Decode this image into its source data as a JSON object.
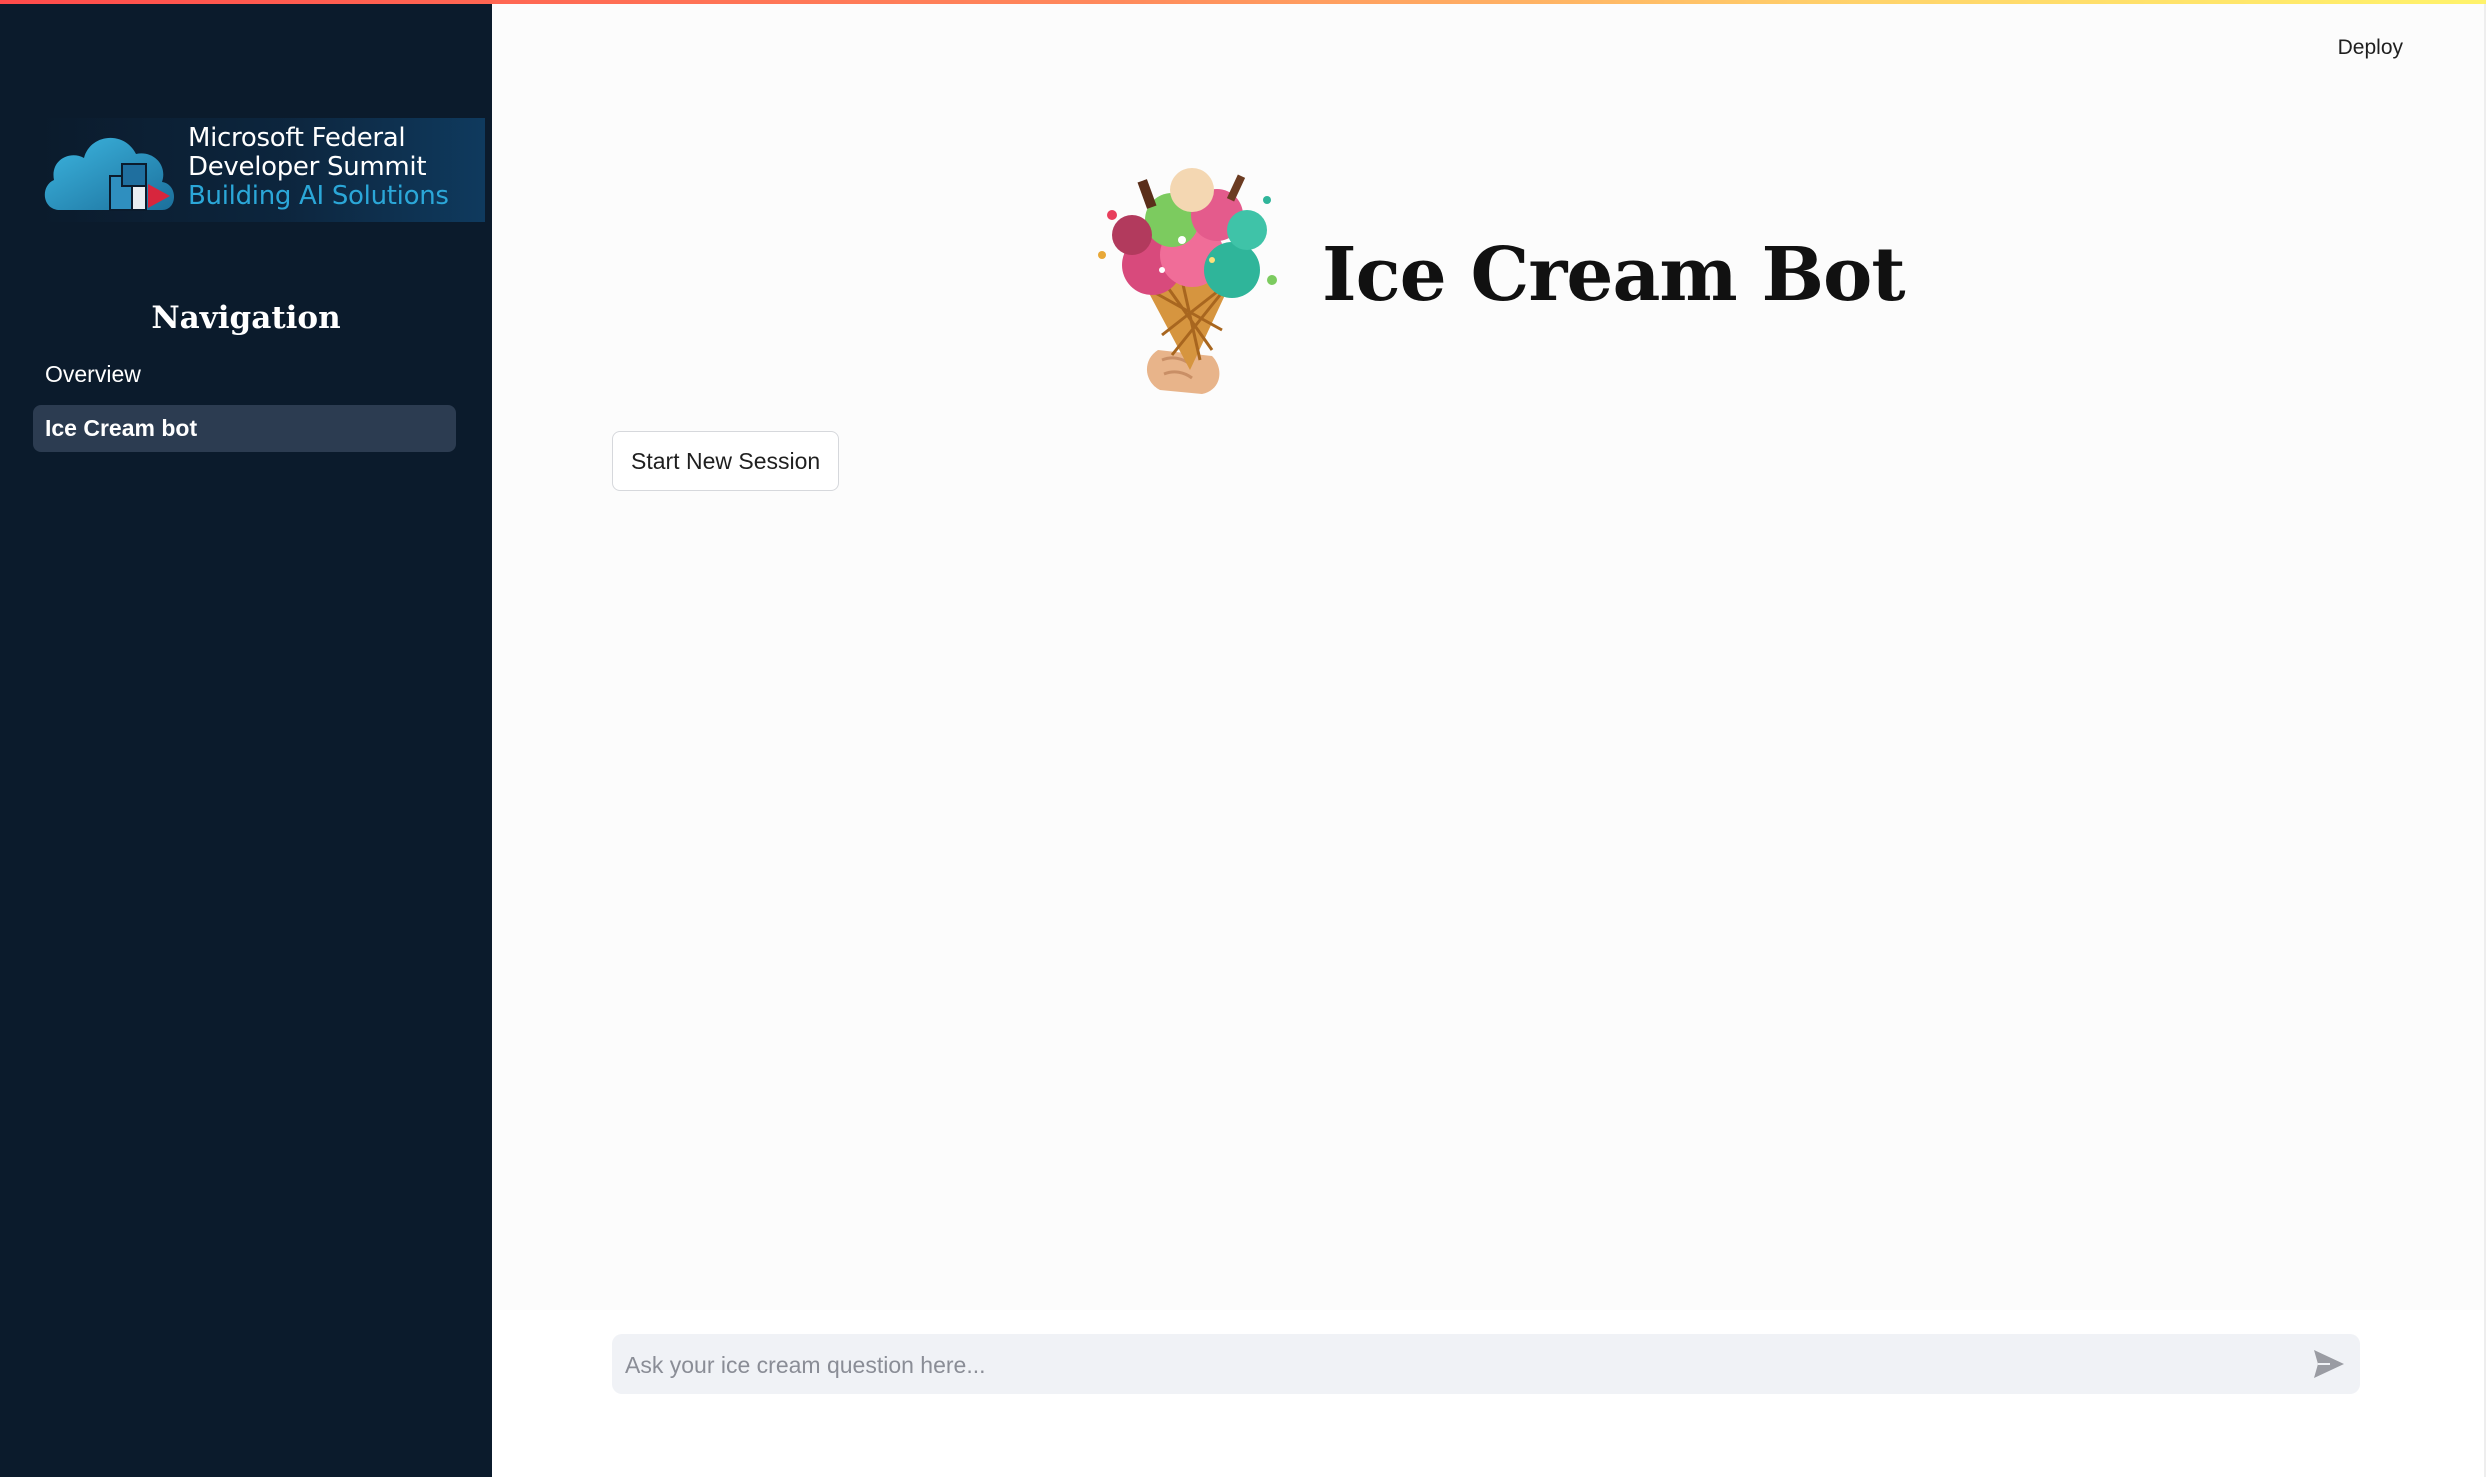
{
  "sidebar": {
    "logo": {
      "line1": "Microsoft Federal",
      "line2": "Developer Summit",
      "line3": "Building AI Solutions"
    },
    "nav_heading": "Navigation",
    "items": [
      {
        "label": "Overview",
        "active": false
      },
      {
        "label": "Ice Cream bot",
        "active": true
      }
    ]
  },
  "header": {
    "deploy_label": "Deploy"
  },
  "main": {
    "title": "Ice Cream Bot",
    "start_session_label": "Start New Session"
  },
  "chat": {
    "placeholder": "Ask your ice cream question here..."
  },
  "colors": {
    "sidebar_bg": "#0b1b2c",
    "active_item_bg": "#2c3c51",
    "main_bg": "#fcfcfc",
    "accent_logo": "#2ba7d8"
  }
}
